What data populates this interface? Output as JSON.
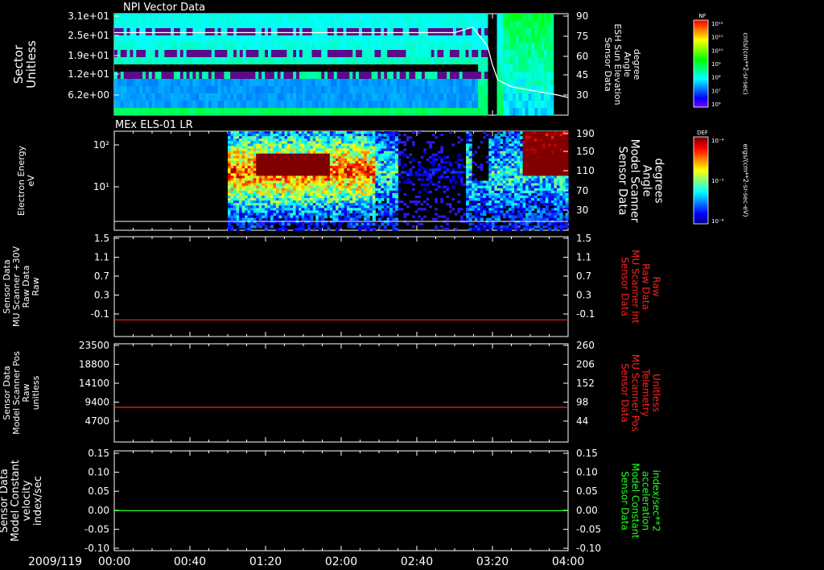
{
  "date_label": "2009/119",
  "time_ticks": [
    "00:00",
    "00:40",
    "01:20",
    "02:00",
    "02:40",
    "03:20",
    "04:00"
  ],
  "chart_data": [
    {
      "id": "npi",
      "type": "heatmap",
      "title": "NPI Vector Data",
      "ylabel": [
        "Sector",
        "Unitless"
      ],
      "y_ticks": [
        "3.1e+01",
        "2.5e+01",
        "1.9e+01",
        "1.2e+01",
        "6.2e+00"
      ],
      "ylabel_right": [
        "Sensor Data",
        "ESH Sun Elevation",
        "Angle",
        "degree"
      ],
      "y_ticks_right": [
        "90",
        "75",
        "60",
        "45",
        "30"
      ],
      "ylim_right": [
        15,
        90
      ],
      "overlay_line": {
        "color": "#ffffff",
        "x_hours": [
          0.0,
          2.5,
          3.0,
          3.16,
          3.29,
          3.33,
          3.38,
          3.5,
          3.7,
          3.9,
          4.0
        ],
        "y_deg": [
          76,
          76,
          76,
          80,
          66,
          53,
          41,
          36,
          33,
          30,
          28
        ]
      },
      "colorbar": {
        "label": "NF",
        "unit": "cnts/(cm**2-sr-sec)",
        "ticks": [
          "10¹²",
          "10¹¹",
          "10¹⁰",
          "10⁹",
          "10⁸",
          "10⁷",
          "10⁶"
        ]
      }
    },
    {
      "id": "els",
      "type": "heatmap",
      "title": "MEx ELS-01 LR",
      "ylabel": [
        "Electron Energy",
        "eV"
      ],
      "y_ticks": [
        "10²",
        "10¹"
      ],
      "ylabel_right": [
        "Sensor Data",
        "Model Scanner",
        "Angle",
        "degrees"
      ],
      "y_ticks_right": [
        "190",
        "150",
        "110",
        "70",
        "30"
      ],
      "ylim_right": [
        0,
        190
      ],
      "overlay_line": {
        "color": "#ffffff",
        "value": 10
      },
      "colorbar": {
        "label": "DEF",
        "unit": "ergs/(cm**2-sr-sec-eV)",
        "ticks": [
          "10⁻⁴",
          "10⁻⁵",
          "10⁻⁶"
        ]
      }
    },
    {
      "id": "scanner_int",
      "type": "line",
      "ylabel": [
        "Sensor Data",
        "MU Scanner +30V",
        "Raw Data",
        "Raw"
      ],
      "y_ticks": [
        "1.5",
        "1.1",
        "0.7",
        "0.3",
        "-0.1"
      ],
      "ylim": [
        -0.3,
        1.5
      ],
      "ylabel_right": [
        "Sensor Data",
        "MU Scanner Int",
        "Raw Data",
        "Raw"
      ],
      "y_ticks_right": [
        "1.5",
        "1.1",
        "0.7",
        "0.3",
        "-0.1"
      ],
      "right_label_color": "#ff2020",
      "series": [
        {
          "color": "#ff2020",
          "value": 0.0
        }
      ]
    },
    {
      "id": "scanner_pos",
      "type": "line",
      "ylabel": [
        "Sensor Data",
        "Model Scanner Pos",
        "Raw",
        "unitless"
      ],
      "y_ticks": [
        "23500",
        "18800",
        "14100",
        "9400",
        "4700"
      ],
      "ylim": [
        0,
        23500
      ],
      "ylabel_right": [
        "Sensor Data",
        "MU Scanner Pos",
        "Telemetry",
        "Unitless"
      ],
      "y_ticks_right": [
        "260",
        "206",
        "152",
        "98",
        "44"
      ],
      "right_label_color": "#ff2020",
      "series": [
        {
          "color": "#ff2020",
          "value": 8300
        }
      ]
    },
    {
      "id": "velocity",
      "type": "line",
      "ylabel": [
        "Sensor Data",
        "Model Constant",
        "velocity",
        "index/sec"
      ],
      "y_ticks": [
        "0.15",
        "0.10",
        "0.05",
        "0.00",
        "-0.05",
        "-0.10"
      ],
      "ylim": [
        -0.1,
        0.15
      ],
      "ylabel_right": [
        "Sensor Data",
        "Model Constant",
        "acceleration",
        "index/sec**2"
      ],
      "y_ticks_right": [
        "0.15",
        "0.10",
        "0.05",
        "0.00",
        "-0.05",
        "-0.10"
      ],
      "right_label_color": "#20ff20",
      "series": [
        {
          "color": "#20ff20",
          "value": 0.0
        }
      ]
    }
  ]
}
